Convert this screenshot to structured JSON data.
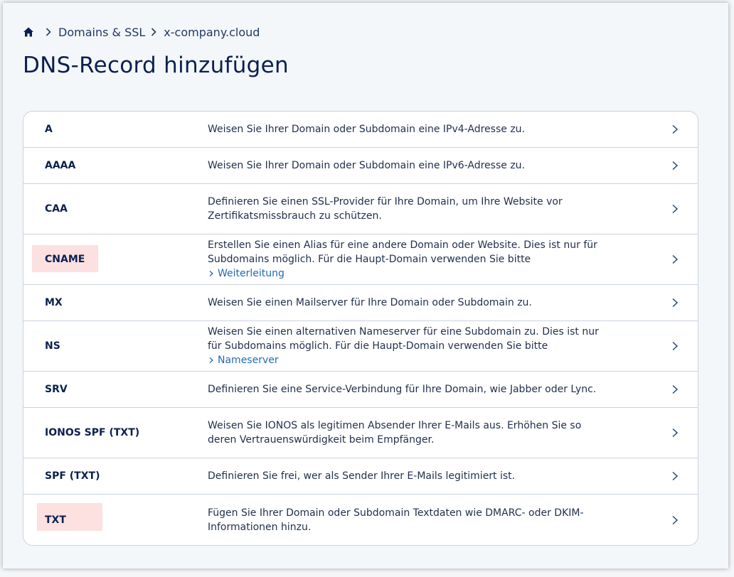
{
  "breadcrumb": {
    "home_icon": "home-icon",
    "items": [
      "Domains & SSL",
      "x-company.cloud"
    ]
  },
  "page": {
    "title": "DNS-Record hinzufügen"
  },
  "records": [
    {
      "type": "A",
      "description": "Weisen Sie Ihrer Domain oder Subdomain eine IPv4-Adresse zu."
    },
    {
      "type": "AAAA",
      "description": "Weisen Sie Ihrer Domain oder Subdomain eine IPv6-Adresse zu."
    },
    {
      "type": "CAA",
      "description": "Definieren Sie einen SSL-Provider für Ihre Domain, um Ihre Website vor Zertifikatsmissbrauch zu schützen."
    },
    {
      "type": "CNAME",
      "description": "Erstellen Sie einen Alias für eine andere Domain oder Website. Dies ist nur für Subdomains möglich. Für die Haupt-Domain verwenden Sie bitte",
      "link": "Weiterleitung"
    },
    {
      "type": "MX",
      "description": "Weisen Sie einen Mailserver für Ihre Domain oder Subdomain zu."
    },
    {
      "type": "NS",
      "description": "Weisen Sie einen alternativen Nameserver für eine Subdomain zu. Dies ist nur für Subdomains möglich. Für die Haupt-Domain verwenden Sie bitte",
      "link": "Nameserver"
    },
    {
      "type": "SRV",
      "description": "Definieren Sie eine Service-Verbindung für Ihre Domain, wie Jabber oder Lync."
    },
    {
      "type": "IONOS SPF (TXT)",
      "description": "Weisen Sie IONOS als legitimen Absender Ihrer E-Mails aus. Erhöhen Sie so deren Vertrauenswürdigkeit beim Empfänger."
    },
    {
      "type": "SPF (TXT)",
      "description": "Definieren Sie frei, wer als Sender Ihrer E-Mails legitimiert ist."
    },
    {
      "type": "TXT",
      "description": "Fügen Sie Ihrer Domain oder Subdomain Textdaten wie DMARC- oder DKIM-Informationen hinzu."
    }
  ],
  "colors": {
    "highlight": "#fde0e0",
    "link": "#1f6ab8",
    "title": "#0b2050"
  }
}
